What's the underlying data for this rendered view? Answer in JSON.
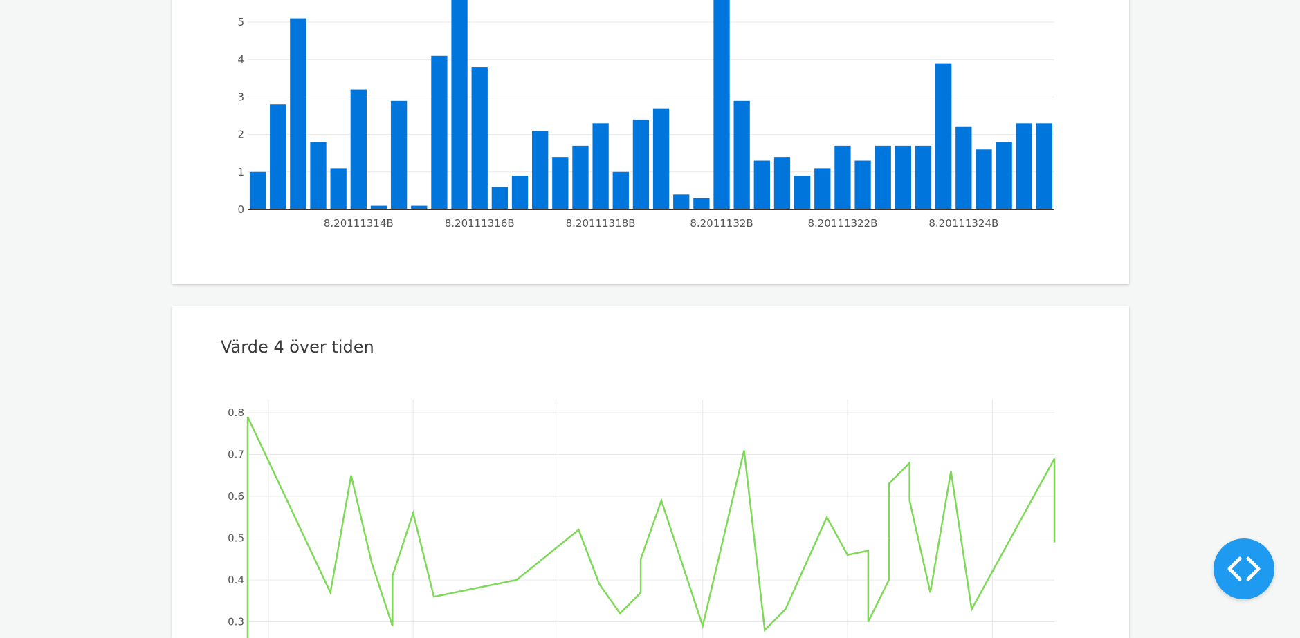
{
  "colors": {
    "bar": "#0075dc",
    "line": "#7ed957",
    "grid": "#e8e8e8",
    "axis": "#333333"
  },
  "fab": {
    "icon": "code-icon"
  },
  "chart_data": [
    {
      "type": "bar",
      "title": "",
      "xlabel": "",
      "ylabel": "",
      "ylim": [
        0,
        5.5
      ],
      "y_ticks": [
        0,
        1,
        2,
        3,
        4,
        5
      ],
      "x_tick_labels": [
        "8.20111314B",
        "8.20111316B",
        "8.20111318B",
        "8.2011132B",
        "8.20111322B",
        "8.20111324B"
      ],
      "values": [
        1.0,
        2.8,
        5.1,
        1.8,
        1.1,
        3.2,
        0.1,
        2.9,
        0.1,
        4.1,
        5.7,
        3.8,
        0.6,
        0.9,
        2.1,
        1.4,
        1.7,
        2.3,
        1.0,
        2.4,
        2.7,
        0.4,
        0.3,
        5.7,
        2.9,
        1.3,
        1.4,
        0.9,
        1.1,
        1.7,
        1.3,
        1.7,
        1.7,
        1.7,
        3.9,
        2.2,
        1.6,
        1.8,
        2.3,
        2.3
      ],
      "grid": true
    },
    {
      "type": "line",
      "title": "Värde 4 över tiden",
      "xlabel": "",
      "ylabel": "",
      "ylim": [
        0.3,
        0.8
      ],
      "y_ticks": [
        0.3,
        0.4,
        0.5,
        0.6,
        0.7,
        0.8
      ],
      "grid": true,
      "points": [
        [
          0,
          0.2
        ],
        [
          0,
          0.79
        ],
        [
          4,
          0.37
        ],
        [
          5,
          0.65
        ],
        [
          6,
          0.44
        ],
        [
          7,
          0.29
        ],
        [
          7,
          0.41
        ],
        [
          8,
          0.56
        ],
        [
          9,
          0.36
        ],
        [
          13,
          0.4
        ],
        [
          16,
          0.52
        ],
        [
          17,
          0.39
        ],
        [
          18,
          0.32
        ],
        [
          19,
          0.37
        ],
        [
          19,
          0.45
        ],
        [
          20,
          0.59
        ],
        [
          22,
          0.29
        ],
        [
          24,
          0.71
        ],
        [
          25,
          0.28
        ],
        [
          26,
          0.33
        ],
        [
          28,
          0.55
        ],
        [
          29,
          0.46
        ],
        [
          30,
          0.47
        ],
        [
          30,
          0.3
        ],
        [
          31,
          0.4
        ],
        [
          31,
          0.63
        ],
        [
          32,
          0.68
        ],
        [
          32,
          0.59
        ],
        [
          33,
          0.37
        ],
        [
          34,
          0.66
        ],
        [
          35,
          0.33
        ],
        [
          39,
          0.69
        ],
        [
          39,
          0.49
        ]
      ]
    }
  ]
}
